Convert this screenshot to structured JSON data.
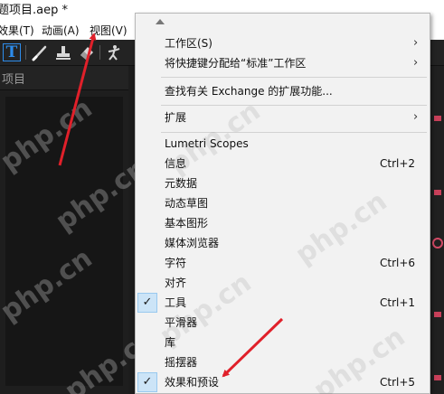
{
  "title": "题项目.aep *",
  "menubar": {
    "items": [
      "效果(T)",
      "动画(A)",
      "视图(V)"
    ]
  },
  "panel": {
    "title": "项目"
  },
  "tools": {
    "type_glyph": "T"
  },
  "dropdown": {
    "items": [
      {
        "label": "工作区(S)",
        "submenu": true
      },
      {
        "label": "将快捷键分配给“标准”工作区",
        "submenu": true
      },
      {
        "label": "查找有关 Exchange 的扩展功能..."
      },
      {
        "label": "扩展",
        "submenu": true
      },
      {
        "label": "Lumetri Scopes"
      },
      {
        "label": "信息",
        "shortcut": "Ctrl+2"
      },
      {
        "label": "元数据"
      },
      {
        "label": "动态草图"
      },
      {
        "label": "基本图形"
      },
      {
        "label": "媒体浏览器"
      },
      {
        "label": "字符",
        "shortcut": "Ctrl+6"
      },
      {
        "label": "对齐"
      },
      {
        "label": "工具",
        "shortcut": "Ctrl+1",
        "checked": true
      },
      {
        "label": "平滑器"
      },
      {
        "label": "库"
      },
      {
        "label": "摇摆器"
      },
      {
        "label": "效果和预设",
        "shortcut": "Ctrl+5",
        "checked": true
      }
    ],
    "submenu_glyph": "›",
    "check_glyph": "✓"
  },
  "watermark": "php.cn",
  "colors": {
    "accent_blue": "#2d8ceb",
    "annotation_red": "#e0202a",
    "check_bg": "#cce4f7"
  }
}
